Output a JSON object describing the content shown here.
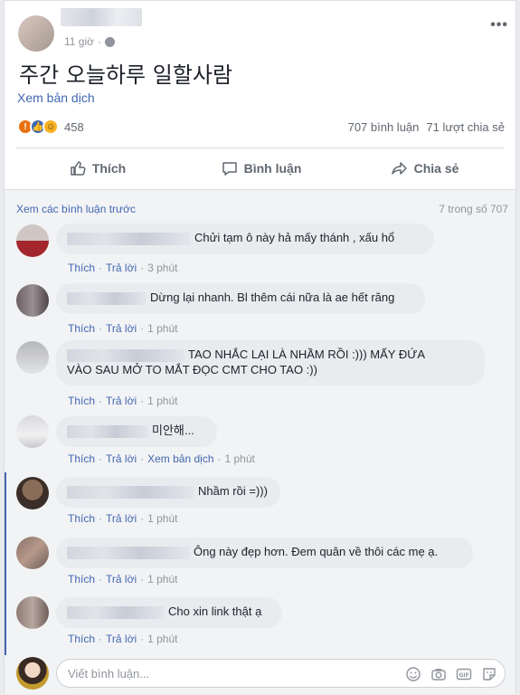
{
  "post": {
    "time": "11 giờ",
    "text": "주간 오늘하루 일할사람",
    "see_translation": "Xem bản dịch",
    "reaction_count": "458",
    "comments_count": "707 bình luận",
    "shares_count": "71 lượt chia sẻ",
    "reactions": [
      "angry-icon",
      "like-icon",
      "haha-icon"
    ]
  },
  "actions": {
    "like": "Thích",
    "comment": "Bình luận",
    "share": "Chia sẻ"
  },
  "comments_section": {
    "view_previous": "Xem các bình luận trước",
    "count_label": "7 trong số 707"
  },
  "comments": [
    {
      "text": "Chửi tạm ô này hả mấy thánh , xấu hổ",
      "like": "Thích",
      "reply": "Trả lời",
      "time": "3 phút"
    },
    {
      "text": "Dừng lại nhanh. Bl thêm cái nữa là ae hết răng",
      "like": "Thích",
      "reply": "Trả lời",
      "time": "1 phút"
    },
    {
      "text_line1": "TAO NHẮC LẠI LÀ NHẦM RỒI :))) MẤY ĐỨA",
      "text_line2": "VÀO SAU MỞ TO MẮT ĐỌC CMT CHO TAO :))",
      "like": "Thích",
      "reply": "Trả lời",
      "time": "1 phút"
    },
    {
      "text": "미안해...",
      "like": "Thích",
      "reply": "Trả lời",
      "translate": "Xem bản dịch",
      "time": "1 phút"
    },
    {
      "text": "Nhầm rồi =)))",
      "like": "Thích",
      "reply": "Trả lời",
      "time": "1 phút"
    },
    {
      "text": "Ông này đẹp hơn. Đem quân về thôi các mẹ ạ.",
      "like": "Thích",
      "reply": "Trả lời",
      "time": "1 phút"
    },
    {
      "text": "Cho xin link thật ạ",
      "like": "Thích",
      "reply": "Trả lời",
      "time": "1 phút"
    }
  ],
  "composer": {
    "placeholder": "Viết bình luận...",
    "icons": [
      "emoji-icon",
      "camera-icon",
      "gif-icon",
      "sticker-icon"
    ]
  },
  "colors": {
    "link": "#4267b2",
    "muted": "#90949c",
    "bubble": "#e9ebee"
  }
}
